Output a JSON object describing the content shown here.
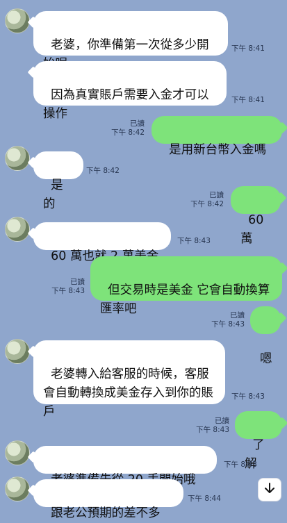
{
  "messages": [
    {
      "id": "m1",
      "side": "in",
      "text": "老婆，你準備第一次從多少開始呢",
      "time": "下午 8:41"
    },
    {
      "id": "m2",
      "side": "in",
      "text": "因為真實賬戶需要入金才可以操作",
      "time": "下午 8:41"
    },
    {
      "id": "m3",
      "side": "out",
      "text": "是用新台幣入金嗎",
      "read": "已讀",
      "time": "下午 8:42"
    },
    {
      "id": "m4",
      "side": "in",
      "text": "是的",
      "time": "下午 8:42"
    },
    {
      "id": "m5",
      "side": "out",
      "text": "60 萬",
      "read": "已讀",
      "time": "下午 8:42"
    },
    {
      "id": "m6",
      "side": "in",
      "text": "60 萬也就 2 萬美金",
      "time": "下午 8:43"
    },
    {
      "id": "m7",
      "side": "out",
      "text": "但交易時是美金 它會自動換算匯率吧",
      "read": "已讀",
      "time": "下午 8:43"
    },
    {
      "id": "m8",
      "side": "out",
      "text": "嗯",
      "read": "已讀",
      "time": "下午 8:43"
    },
    {
      "id": "m9",
      "side": "in",
      "text": "老婆轉入給客服的時候，客服會自動轉換成美金存入到你的賬戶",
      "time": "下午 8:43"
    },
    {
      "id": "m10",
      "side": "out",
      "text": "了解",
      "read": "已讀",
      "time": "下午 8:43"
    },
    {
      "id": "m11",
      "side": "in",
      "text": "老婆準備先從 20 手開始哦",
      "time": "下午 8:43"
    },
    {
      "id": "m12",
      "side": "in",
      "text": "跟老公預期的差不多",
      "time": "下午 8:44"
    }
  ],
  "icons": {
    "avatar": "avatar-icon",
    "scroll": "arrow-down-icon"
  }
}
